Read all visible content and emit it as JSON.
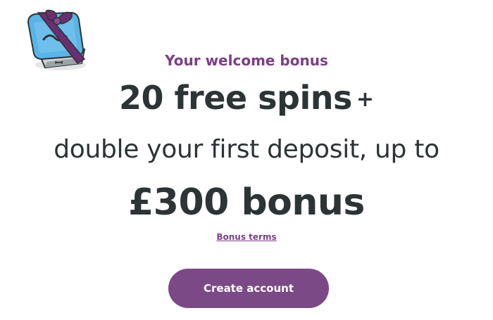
{
  "promo": {
    "label": "Your welcome bonus",
    "headline_main": "20 free spins",
    "headline_plus": "+",
    "headline_second": "double your first deposit, up to",
    "headline_amount": "£300 bonus",
    "terms_link": "Bonus terms"
  },
  "cta": {
    "label": "Create account"
  },
  "icons": {
    "gift": "gift-box-icon"
  },
  "colors": {
    "accent": "#7b3f86",
    "button": "#7b4a86",
    "text": "#2d3436",
    "gift_box": "#5bb4e6",
    "ribbon": "#6a2f70"
  }
}
